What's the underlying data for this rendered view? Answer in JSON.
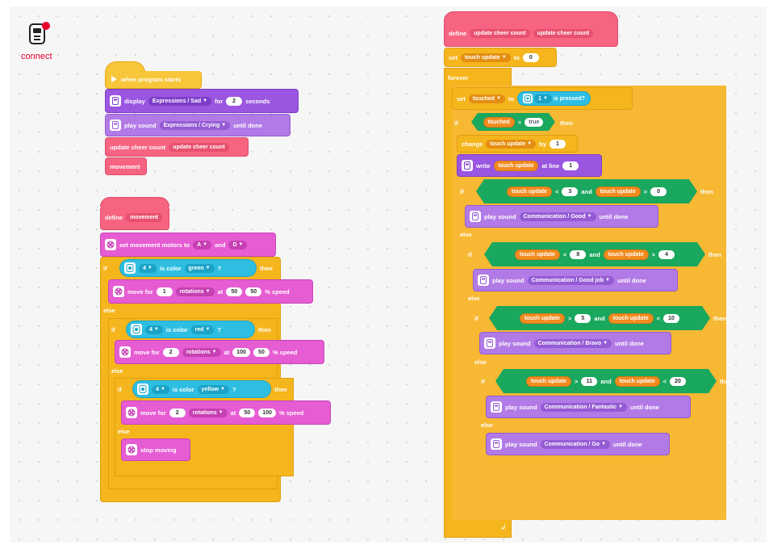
{
  "connect": {
    "label": "connect"
  },
  "left_script": {
    "hat": "when program starts",
    "display": {
      "prefix": "display",
      "value": "Expressions / Sad",
      "for": "for",
      "num": "2",
      "suffix": "seconds"
    },
    "play1": {
      "prefix": "play sound",
      "value": "Expressions / Crying",
      "suffix": "until done"
    },
    "update": {
      "label": "update cheer count",
      "arg": "update cheer count"
    },
    "movement": "movement"
  },
  "def_movement": {
    "define": "define",
    "name": "movement",
    "set_motors": {
      "label": "set movement motors to",
      "a": "A",
      "and": "and",
      "d": "D"
    },
    "if": "if",
    "then": "then",
    "else": "else",
    "sensor1": {
      "port": "4",
      "is_color": "is color",
      "color": "green",
      "q": "?"
    },
    "move1": {
      "prefix": "move for",
      "n": "1",
      "unit": "rotations",
      "at": "at",
      "a": "50",
      "b": "50",
      "suffix": "% speed"
    },
    "sensor2": {
      "port": "4",
      "is_color": "is color",
      "color": "red",
      "q": "?"
    },
    "move2": {
      "prefix": "move for",
      "n": "2",
      "unit": "rotations",
      "at": "at",
      "a": "100",
      "b": "50",
      "suffix": "% speed"
    },
    "sensor3": {
      "port": "4",
      "is_color": "is color",
      "color": "yellow",
      "q": "?"
    },
    "move3": {
      "prefix": "move for",
      "n": "2",
      "unit": "rotations",
      "at": "at",
      "a": "50",
      "b": "100",
      "suffix": "% speed"
    },
    "stop": "stop moving"
  },
  "def_cheer": {
    "define": "define",
    "name": "update cheer count",
    "arg": "update cheer count",
    "set1": {
      "set": "set",
      "var": "touch update",
      "to": "to",
      "val": "0"
    },
    "forever": "forever",
    "set2": {
      "set": "set",
      "var": "touched",
      "to": "to",
      "port": "1",
      "pressed": "is pressed?"
    },
    "if": "if",
    "then": "then",
    "else": "else",
    "and": "and",
    "cond_touched": {
      "var": "touched",
      "eq": "=",
      "val": "true"
    },
    "change": {
      "label": "change",
      "var": "touch update",
      "by": "by",
      "val": "1"
    },
    "write": {
      "label": "write",
      "var": "touch update",
      "at": "at line",
      "val": "1"
    },
    "c1": {
      "a": "touch update",
      "op1": "<",
      "n1": "3",
      "b": "touch update",
      "op2": ">",
      "n2": "0"
    },
    "s1": {
      "prefix": "play sound",
      "value": "Communication / Good",
      "suffix": "until done"
    },
    "c2": {
      "a": "touch update",
      "op1": "<",
      "n1": "8",
      "b": "touch update",
      "op2": ">",
      "n2": "4"
    },
    "s2": {
      "prefix": "play sound",
      "value": "Communication / Good job",
      "suffix": "until done"
    },
    "c3": {
      "a": "touch update",
      "op1": ">",
      "n1": "5",
      "b": "touch update",
      "op2": "<",
      "n2": "10"
    },
    "s3": {
      "prefix": "play sound",
      "value": "Communication / Bravo",
      "suffix": "until done"
    },
    "c4": {
      "a": "touch update",
      "op1": ">",
      "n1": "11",
      "b": "touch update",
      "op2": "<",
      "n2": "20"
    },
    "s4": {
      "prefix": "play sound",
      "value": "Communication / Fantastic",
      "suffix": "until done"
    },
    "s5": {
      "prefix": "play sound",
      "value": "Communication / Go",
      "suffix": "until done"
    }
  },
  "colors": {
    "yellow": "#f5b51c",
    "purple": "#9a56e0",
    "pink": "#f76482",
    "magenta": "#e65cd3",
    "cyan": "#2ebee2",
    "green": "#1aa75e",
    "orange": "#fbb128"
  }
}
